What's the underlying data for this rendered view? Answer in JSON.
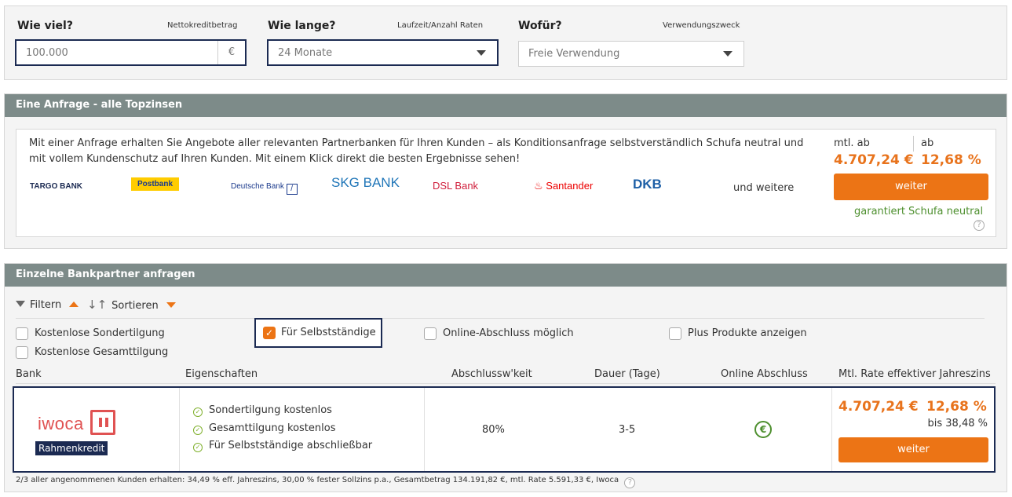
{
  "top": {
    "amount_label": "Wie viel?",
    "amount_sub": "Nettokreditbetrag",
    "amount_value": "100.000",
    "amount_unit": "€",
    "duration_label": "Wie lange?",
    "duration_sub": "Laufzeit/Anzahl Raten",
    "duration_value": "24 Monate",
    "purpose_label": "Wofür?",
    "purpose_sub": "Verwendungszweck",
    "purpose_value": "Freie Verwendung"
  },
  "request": {
    "header": "Eine Anfrage - alle Topzinsen",
    "text": "Mit einer Anfrage erhalten Sie Angebote aller relevanten Partnerbanken für Ihren Kunden – als Konditionsanfrage selbstverständlich Schufa neutral und mit vollem Kundenschutz auf Ihren Kunden. Mit einem Klick direkt die besten Ergebnisse sehen!",
    "banks": [
      "TARGO BANK",
      "Postbank",
      "Deutsche Bank",
      "SKG BANK",
      "DSL Bank",
      "Santander",
      "DKB"
    ],
    "and_more": "und weitere",
    "mtl_label": "mtl. ab",
    "ab_label": "ab",
    "rate": "4.707,24 €",
    "interest": "12,68 %",
    "button": "weiter",
    "schufa": "garantiert Schufa neutral",
    "help": "?"
  },
  "single": {
    "header": "Einzelne Bankpartner anfragen",
    "filter_label": "Filtern",
    "sort_label": "Sortieren",
    "checkboxes": [
      {
        "label": "Kostenlose Sondertilgung",
        "checked": false
      },
      {
        "label": "Für Selbstständige",
        "checked": true
      },
      {
        "label": "Online-Abschluss möglich",
        "checked": false
      },
      {
        "label": "Plus Produkte anzeigen",
        "checked": false
      },
      {
        "label": "Kostenlose Gesamttilgung",
        "checked": false
      }
    ],
    "columns": [
      "Bank",
      "Eigenschaften",
      "Abschlussw'keit",
      "Dauer (Tage)",
      "Online Abschluss",
      "Mtl. Rate effektiver Jahreszins"
    ],
    "row": {
      "bank_name": "iwoca",
      "product": "Rahmenkredit",
      "features": [
        "Sondertilgung kostenlos",
        "Gesamttilgung kostenlos",
        "Für Selbstständige abschließbar"
      ],
      "probability": "80%",
      "duration": "3-5",
      "rate": "4.707,24 €",
      "interest": "12,68 %",
      "interest_max": "bis 38,48 %",
      "button": "weiter"
    },
    "footnote": "2/3 aller angenommenen Kunden erhalten:  34,49 % eff. Jahreszins,  30,00 % fester Sollzins p.a.,  Gesamtbetrag 134.191,82 €,  mtl. Rate  5.591,33 €,  Iwoca"
  },
  "colors": {
    "accent": "#ec7415",
    "header_bg": "#7d8b89",
    "focus_border": "#1b2a52",
    "green": "#4d8f2e"
  }
}
